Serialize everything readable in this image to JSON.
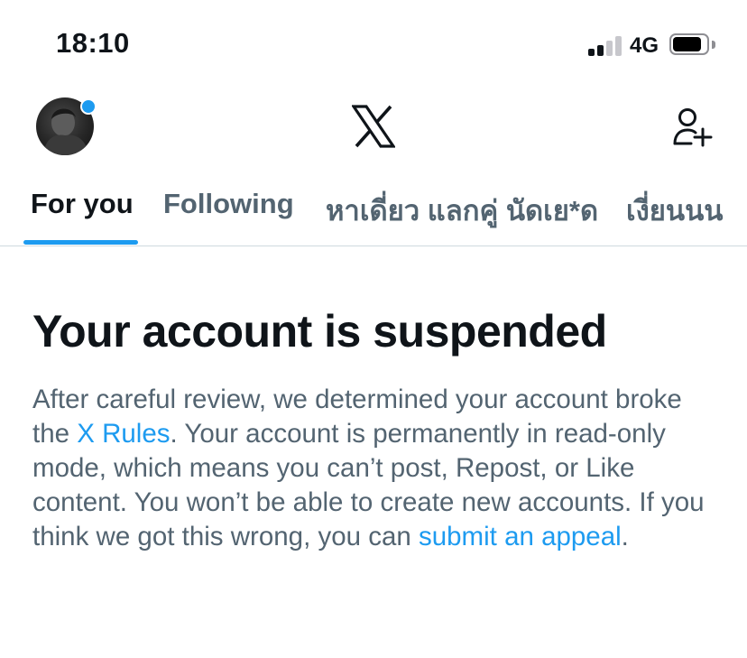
{
  "status_bar": {
    "time": "18:10",
    "network": "4G",
    "signal_bars_active": 2,
    "signal_bars_total": 4,
    "battery_level": 0.85
  },
  "header": {
    "avatar_icon": "avatar",
    "notification_dot_color": "#1d9bf0",
    "logo_icon": "x-logo-icon",
    "add_user_icon": "add-user-icon"
  },
  "tabs": [
    {
      "label": "For you",
      "active": true
    },
    {
      "label": "Following",
      "active": false
    },
    {
      "label": "หาเดี่ยว แลกคู่ นัดเย*ด",
      "active": false
    },
    {
      "label": "เงี่ยนนน",
      "active": false
    }
  ],
  "notice": {
    "title": "Your account is suspended",
    "body_part1": "After careful review, we determined your account broke the ",
    "rules_link": "X Rules",
    "body_part2": ". Your account is permanently in read-only mode, which means you can’t post, Repost, or Like content. You won’t be able to create new accounts. If you think we got this wrong, you can ",
    "appeal_link": "submit an appeal",
    "body_part3": "."
  },
  "colors": {
    "accent": "#1d9bf0",
    "link": "#1d9bf0",
    "text_primary": "#0f1419",
    "text_secondary": "#536471",
    "divider": "#cfd9de"
  }
}
